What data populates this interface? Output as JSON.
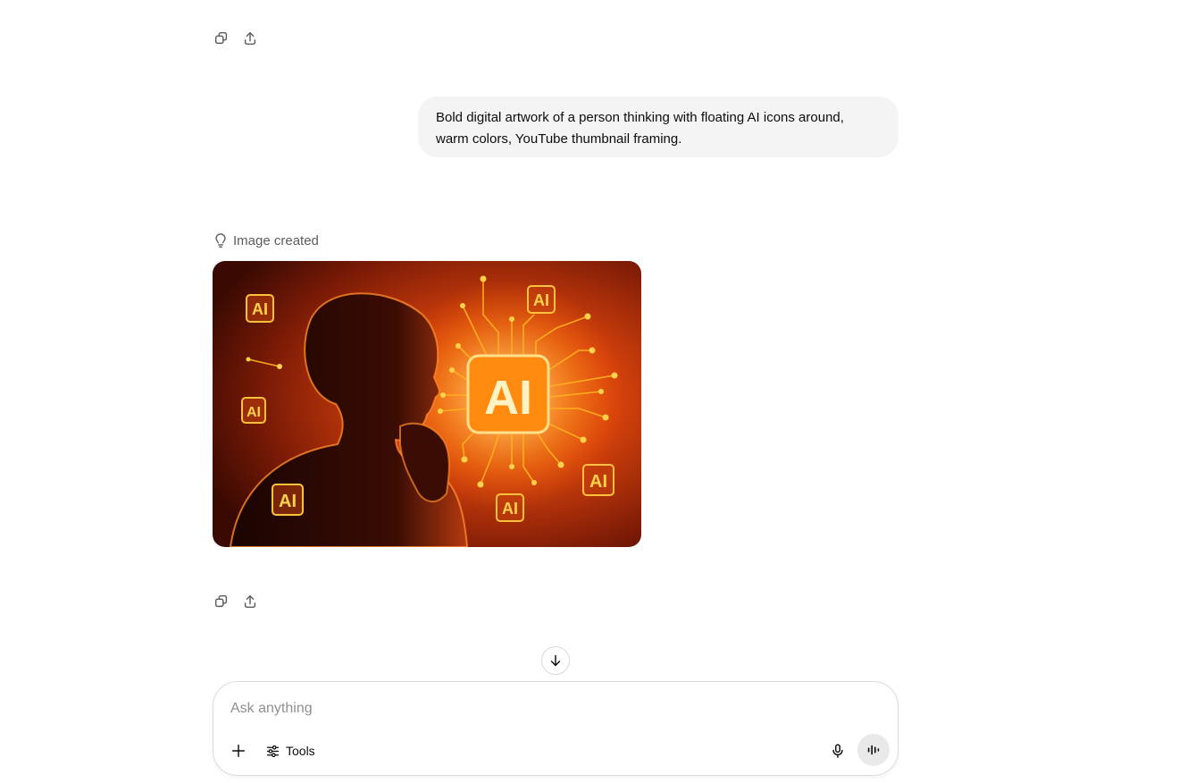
{
  "conversation": {
    "top_actions": [
      {
        "icon": "copy-icon"
      },
      {
        "icon": "share-icon"
      }
    ],
    "user_message": {
      "line1": "Bold digital artwork of a person thinking with floating AI icons around,",
      "line2": "warm colors, YouTube thumbnail framing."
    },
    "assistant": {
      "status_label": "Image created",
      "status_icon": "lightbulb-icon",
      "image": {
        "chip_label": "AI",
        "floating_labels": [
          "AI",
          "AI",
          "AI",
          "AI",
          "AI",
          "AI"
        ]
      },
      "actions": [
        {
          "icon": "copy-icon"
        },
        {
          "icon": "share-icon"
        }
      ]
    }
  },
  "scroll_down": {
    "icon": "arrow-down-icon"
  },
  "composer": {
    "placeholder": "Ask anything",
    "value": "",
    "plus_icon": "plus-icon",
    "tools_label": "Tools",
    "tools_icon": "sliders-icon",
    "mic_icon": "microphone-icon",
    "voice_icon": "voice-waveform-icon"
  },
  "colors": {
    "bubble_bg": "#f4f4f4",
    "accent_glow": "#ffb020",
    "image_bg": "#8a2408"
  }
}
